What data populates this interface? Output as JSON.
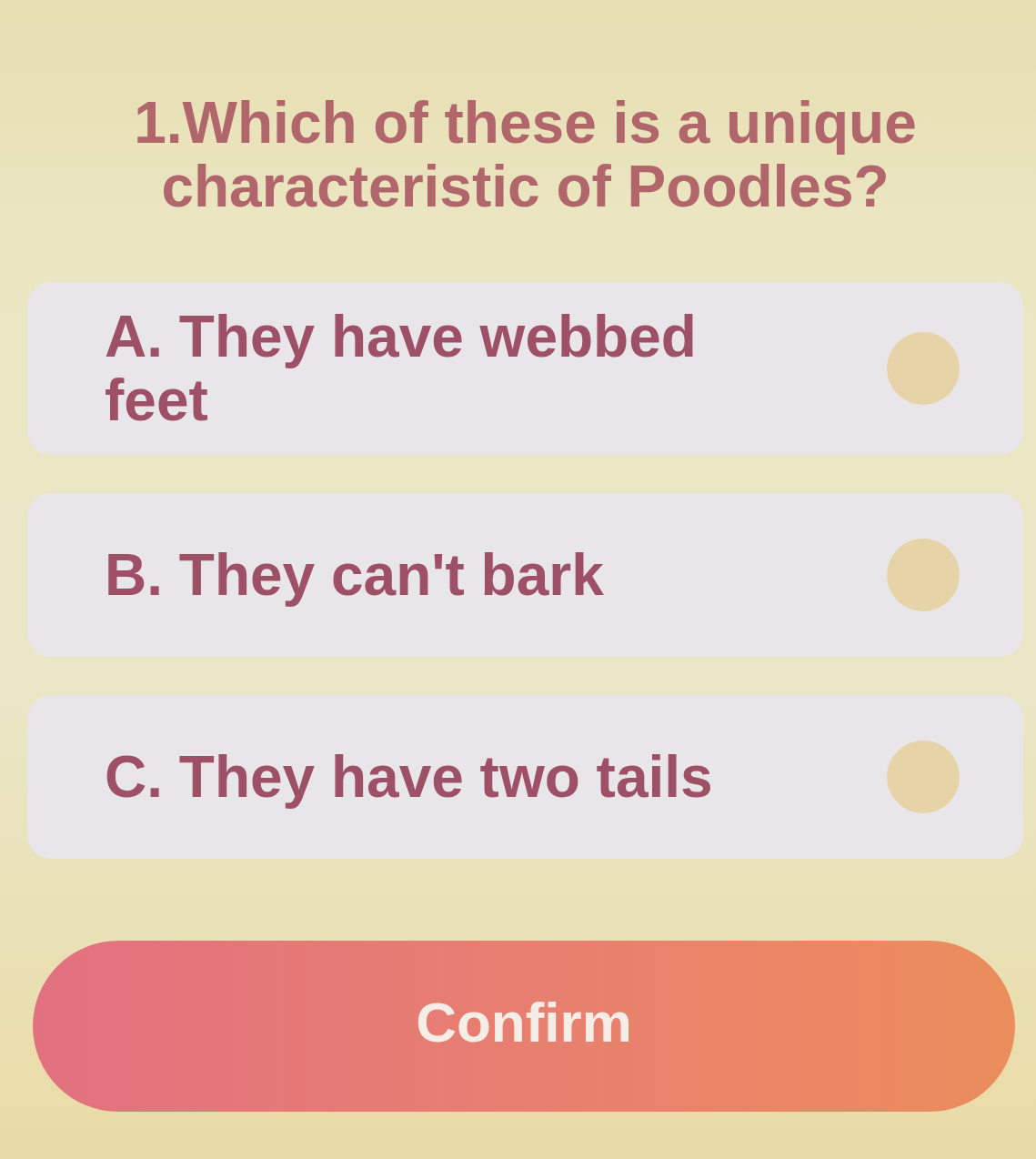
{
  "question": {
    "text": "1.Which of these is a unique characteristic of Poodles?"
  },
  "options": [
    {
      "label": "A. They have webbed feet",
      "selected": false
    },
    {
      "label": "B. They can't bark",
      "selected": false
    },
    {
      "label": "C. They have two tails",
      "selected": false
    }
  ],
  "confirm_button": {
    "label": "Confirm"
  }
}
